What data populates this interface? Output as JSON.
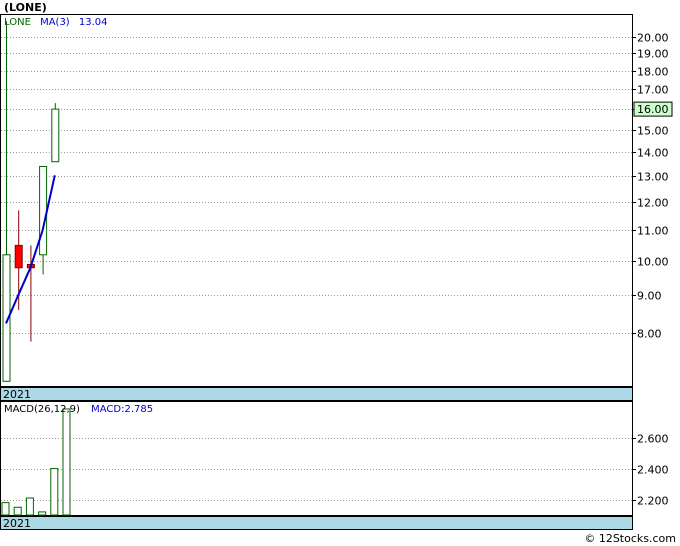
{
  "title": "(LONE)",
  "colors": {
    "up_candle_border": "#006400",
    "down_candle_fill": "#ff0000",
    "down_candle_border": "#8b0000",
    "ma_line": "#0000cc",
    "price_badge_bg": "#ccffcc",
    "band_bg": "#add8e6",
    "grid": "#999999"
  },
  "footer": "© 12Stocks.com",
  "chart_data": [
    {
      "type": "candlestick",
      "name": "price",
      "legend": {
        "symbol": "LONE",
        "ma_label": "MA(3)",
        "ma_value": "13.04"
      },
      "period_label": "2021",
      "current_price": "16.00",
      "y_scale": "log",
      "ylim": [
        6.8,
        21.4
      ],
      "yticks": [
        "8.00",
        "9.00",
        "10.00",
        "11.00",
        "12.00",
        "13.00",
        "14.00",
        "15.00",
        "16.00",
        "17.00",
        "18.00",
        "19.00",
        "20.00"
      ],
      "grid": true,
      "candles": [
        {
          "open": 6.9,
          "high": 21.0,
          "low": 6.9,
          "close": 10.2
        },
        {
          "open": 10.5,
          "high": 11.7,
          "low": 8.6,
          "close": 9.8
        },
        {
          "open": 9.9,
          "high": 10.5,
          "low": 7.8,
          "close": 9.8
        },
        {
          "open": 10.2,
          "high": 13.4,
          "low": 9.6,
          "close": 13.4
        },
        {
          "open": 13.6,
          "high": 16.3,
          "low": 13.6,
          "close": 16.0
        }
      ],
      "ma3": [
        8.25,
        9.0,
        9.8,
        11.0,
        13.04
      ]
    },
    {
      "type": "bar",
      "name": "macd",
      "legend": {
        "label": "MACD(26,12,9)",
        "value_label": "MACD:2.785"
      },
      "period_label": "2021",
      "ylim": [
        2.1,
        2.83
      ],
      "yticks": [
        "2.200",
        "2.400",
        "2.600"
      ],
      "grid": true,
      "values": [
        2.18,
        2.15,
        2.21,
        2.12,
        2.4,
        2.785
      ]
    }
  ]
}
